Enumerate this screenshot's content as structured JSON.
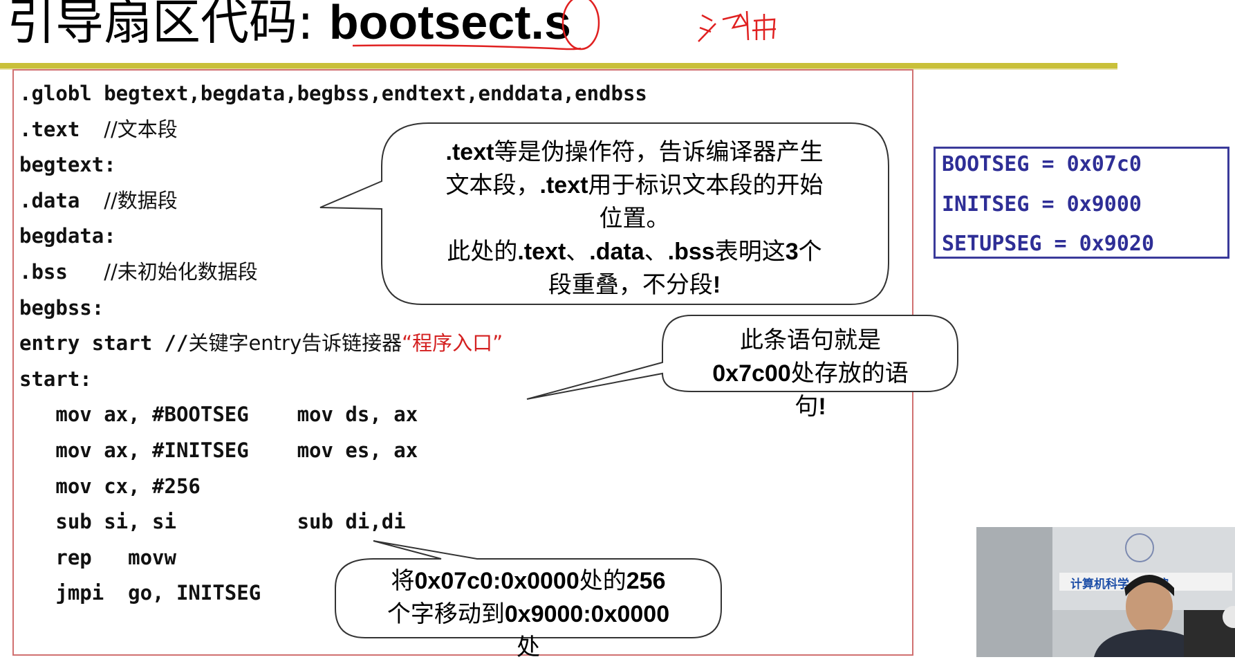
{
  "slide": {
    "title_cn": "引导扇区代码:",
    "title_file": "bootsect.s",
    "handwriting": "汇编"
  },
  "code_lines": [
    ".globl begtext,begdata,begbss,endtext,enddata,endbss",
    ".text  ",
    "//文本段",
    "begtext:",
    ".data  ",
    "//数据段",
    "begdata:",
    ".bss   ",
    "//未初始化数据段",
    "begbss:",
    "entry start //",
    "关键字entry告诉链接器",
    "“程序入口”",
    "start:",
    "   mov ax, #BOOTSEG    mov ds, ax",
    "   mov ax, #INITSEG    mov es, ax",
    "   mov cx, #256",
    "   sub si, si          sub di,di",
    "   rep   movw",
    "   jmpi  go, INITSEG"
  ],
  "callouts": {
    "text_note": {
      "b1": ".text",
      "t1": "等是伪操作符，告诉编译器产生",
      "t2": "文本段，",
      "b2": ".text",
      "t3": "用于标识文本段的开始",
      "t4": "位置。",
      "t5": "此处的",
      "b3": ".text",
      "t6": "、",
      "b4": ".data",
      "t7": "、",
      "b5": ".bss",
      "t8": "表明这",
      "b6": "3",
      "t9": "个",
      "t10": "段重叠，不分段",
      "b7": "!"
    },
    "entry_note": {
      "t1": "此条语句就是",
      "b1": "0x7c00",
      "t2": "处存放的语",
      "t3": "句",
      "b2": "!"
    },
    "move_note": {
      "t1": "将",
      "b1": "0x07c0:0x0000",
      "t2": "处的",
      "b2": "256",
      "t3": "个字移动到",
      "b3": "0x9000:0x0000",
      "t4": "处"
    }
  },
  "segments": [
    "BOOTSEG = 0x07c0",
    "INITSEG = 0x9000",
    "SETUPSEG = 0x9020"
  ],
  "video_overlay": {
    "banner": "计算机科学  术学院"
  },
  "colors": {
    "rule": "#c9c03a",
    "code_border": "#d07070",
    "segment_text": "#2e2e96",
    "handwriting": "#e02020"
  }
}
